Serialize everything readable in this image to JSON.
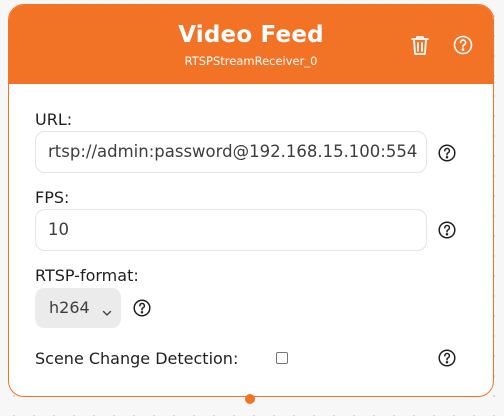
{
  "node": {
    "title": "Video Feed",
    "subtitle": "RTSPStreamReceiver_0",
    "accent_color": "#f37326",
    "header_icons": [
      "trash-icon",
      "help-icon"
    ]
  },
  "fields": {
    "url": {
      "label": "URL:",
      "value": "rtsp://admin:password@192.168.15.100:554"
    },
    "fps": {
      "label": "FPS:",
      "value": "10"
    },
    "rtsp_format": {
      "label": "RTSP-format:",
      "selected": "h264"
    },
    "scene_change": {
      "label": "Scene Change Detection:",
      "checked": false
    }
  }
}
